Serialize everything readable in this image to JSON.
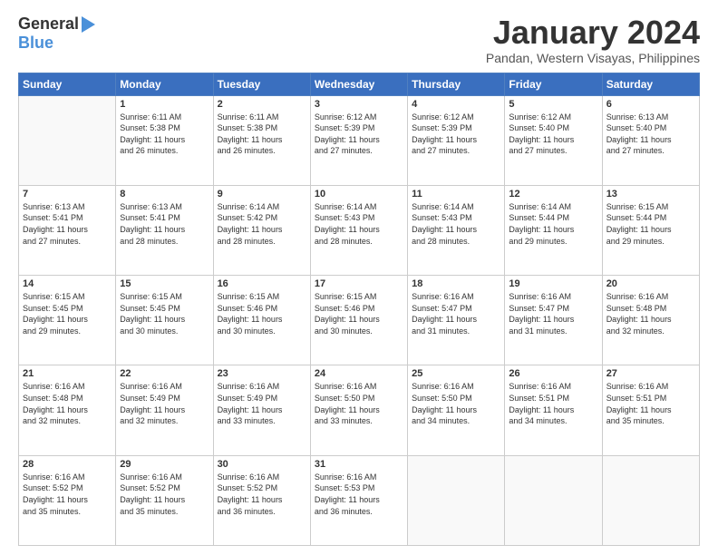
{
  "logo": {
    "line1": "General",
    "line2": "Blue"
  },
  "title": "January 2024",
  "subtitle": "Pandan, Western Visayas, Philippines",
  "days_of_week": [
    "Sunday",
    "Monday",
    "Tuesday",
    "Wednesday",
    "Thursday",
    "Friday",
    "Saturday"
  ],
  "weeks": [
    [
      {
        "day": "",
        "info": ""
      },
      {
        "day": "1",
        "info": "Sunrise: 6:11 AM\nSunset: 5:38 PM\nDaylight: 11 hours\nand 26 minutes."
      },
      {
        "day": "2",
        "info": "Sunrise: 6:11 AM\nSunset: 5:38 PM\nDaylight: 11 hours\nand 26 minutes."
      },
      {
        "day": "3",
        "info": "Sunrise: 6:12 AM\nSunset: 5:39 PM\nDaylight: 11 hours\nand 27 minutes."
      },
      {
        "day": "4",
        "info": "Sunrise: 6:12 AM\nSunset: 5:39 PM\nDaylight: 11 hours\nand 27 minutes."
      },
      {
        "day": "5",
        "info": "Sunrise: 6:12 AM\nSunset: 5:40 PM\nDaylight: 11 hours\nand 27 minutes."
      },
      {
        "day": "6",
        "info": "Sunrise: 6:13 AM\nSunset: 5:40 PM\nDaylight: 11 hours\nand 27 minutes."
      }
    ],
    [
      {
        "day": "7",
        "info": "Sunrise: 6:13 AM\nSunset: 5:41 PM\nDaylight: 11 hours\nand 27 minutes."
      },
      {
        "day": "8",
        "info": "Sunrise: 6:13 AM\nSunset: 5:41 PM\nDaylight: 11 hours\nand 28 minutes."
      },
      {
        "day": "9",
        "info": "Sunrise: 6:14 AM\nSunset: 5:42 PM\nDaylight: 11 hours\nand 28 minutes."
      },
      {
        "day": "10",
        "info": "Sunrise: 6:14 AM\nSunset: 5:43 PM\nDaylight: 11 hours\nand 28 minutes."
      },
      {
        "day": "11",
        "info": "Sunrise: 6:14 AM\nSunset: 5:43 PM\nDaylight: 11 hours\nand 28 minutes."
      },
      {
        "day": "12",
        "info": "Sunrise: 6:14 AM\nSunset: 5:44 PM\nDaylight: 11 hours\nand 29 minutes."
      },
      {
        "day": "13",
        "info": "Sunrise: 6:15 AM\nSunset: 5:44 PM\nDaylight: 11 hours\nand 29 minutes."
      }
    ],
    [
      {
        "day": "14",
        "info": "Sunrise: 6:15 AM\nSunset: 5:45 PM\nDaylight: 11 hours\nand 29 minutes."
      },
      {
        "day": "15",
        "info": "Sunrise: 6:15 AM\nSunset: 5:45 PM\nDaylight: 11 hours\nand 30 minutes."
      },
      {
        "day": "16",
        "info": "Sunrise: 6:15 AM\nSunset: 5:46 PM\nDaylight: 11 hours\nand 30 minutes."
      },
      {
        "day": "17",
        "info": "Sunrise: 6:15 AM\nSunset: 5:46 PM\nDaylight: 11 hours\nand 30 minutes."
      },
      {
        "day": "18",
        "info": "Sunrise: 6:16 AM\nSunset: 5:47 PM\nDaylight: 11 hours\nand 31 minutes."
      },
      {
        "day": "19",
        "info": "Sunrise: 6:16 AM\nSunset: 5:47 PM\nDaylight: 11 hours\nand 31 minutes."
      },
      {
        "day": "20",
        "info": "Sunrise: 6:16 AM\nSunset: 5:48 PM\nDaylight: 11 hours\nand 32 minutes."
      }
    ],
    [
      {
        "day": "21",
        "info": "Sunrise: 6:16 AM\nSunset: 5:48 PM\nDaylight: 11 hours\nand 32 minutes."
      },
      {
        "day": "22",
        "info": "Sunrise: 6:16 AM\nSunset: 5:49 PM\nDaylight: 11 hours\nand 32 minutes."
      },
      {
        "day": "23",
        "info": "Sunrise: 6:16 AM\nSunset: 5:49 PM\nDaylight: 11 hours\nand 33 minutes."
      },
      {
        "day": "24",
        "info": "Sunrise: 6:16 AM\nSunset: 5:50 PM\nDaylight: 11 hours\nand 33 minutes."
      },
      {
        "day": "25",
        "info": "Sunrise: 6:16 AM\nSunset: 5:50 PM\nDaylight: 11 hours\nand 34 minutes."
      },
      {
        "day": "26",
        "info": "Sunrise: 6:16 AM\nSunset: 5:51 PM\nDaylight: 11 hours\nand 34 minutes."
      },
      {
        "day": "27",
        "info": "Sunrise: 6:16 AM\nSunset: 5:51 PM\nDaylight: 11 hours\nand 35 minutes."
      }
    ],
    [
      {
        "day": "28",
        "info": "Sunrise: 6:16 AM\nSunset: 5:52 PM\nDaylight: 11 hours\nand 35 minutes."
      },
      {
        "day": "29",
        "info": "Sunrise: 6:16 AM\nSunset: 5:52 PM\nDaylight: 11 hours\nand 35 minutes."
      },
      {
        "day": "30",
        "info": "Sunrise: 6:16 AM\nSunset: 5:52 PM\nDaylight: 11 hours\nand 36 minutes."
      },
      {
        "day": "31",
        "info": "Sunrise: 6:16 AM\nSunset: 5:53 PM\nDaylight: 11 hours\nand 36 minutes."
      },
      {
        "day": "",
        "info": ""
      },
      {
        "day": "",
        "info": ""
      },
      {
        "day": "",
        "info": ""
      }
    ]
  ]
}
